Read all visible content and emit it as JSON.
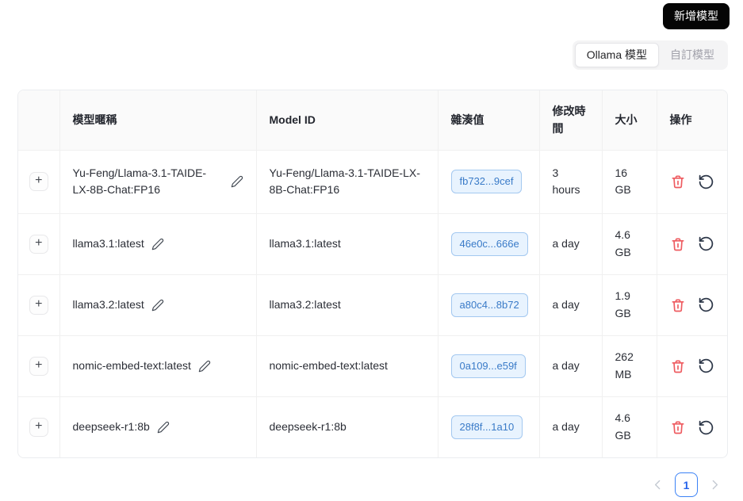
{
  "colors": {
    "accent_blue": "#3b82f6",
    "badge_bg": "#e8f3fe",
    "badge_border": "#a3c8f0",
    "badge_text": "#3a7bc8",
    "danger_red": "#ee5a5f",
    "icon_dark": "#2d3748",
    "header_bg": "#fafafa",
    "button_bg": "#050505"
  },
  "toolbar": {
    "add_model_label": "新增模型"
  },
  "tabs": {
    "ollama_label": "Ollama 模型",
    "custom_label": "自訂模型"
  },
  "table": {
    "expand_symbol": "+",
    "headers": {
      "nickname": "模型暱稱",
      "model_id": "Model ID",
      "hash": "雜湊值",
      "modified": "修改時間",
      "size": "大小",
      "actions": "操作"
    },
    "rows": [
      {
        "nickname": "Yu-Feng/Llama-3.1-TAIDE-LX-8B-Chat:FP16",
        "model_id": "Yu-Feng/Llama-3.1-TAIDE-LX-8B-Chat:FP16",
        "hash": "fb732...9cef",
        "modified": "3 hours",
        "size": "16 GB"
      },
      {
        "nickname": "llama3.1:latest",
        "model_id": "llama3.1:latest",
        "hash": "46e0c...666e",
        "modified": "a day",
        "size": "4.6 GB"
      },
      {
        "nickname": "llama3.2:latest",
        "model_id": "llama3.2:latest",
        "hash": "a80c4...8b72",
        "modified": "a day",
        "size": "1.9 GB"
      },
      {
        "nickname": "nomic-embed-text:latest",
        "model_id": "nomic-embed-text:latest",
        "hash": "0a109...e59f",
        "modified": "a day",
        "size": "262 MB"
      },
      {
        "nickname": "deepseek-r1:8b",
        "model_id": "deepseek-r1:8b",
        "hash": "28f8f...1a10",
        "modified": "a day",
        "size": "4.6 GB"
      }
    ]
  },
  "pagination": {
    "current_page": "1"
  }
}
